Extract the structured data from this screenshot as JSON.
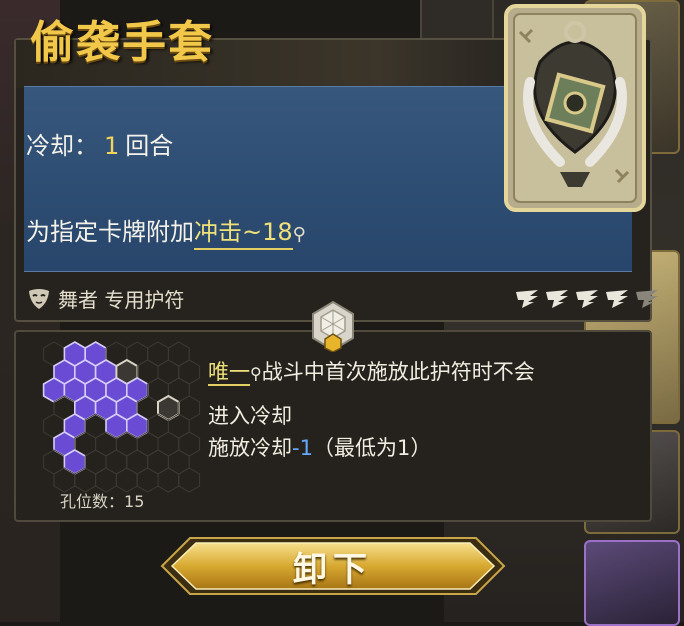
{
  "amulet": {
    "name": "偷袭手套",
    "cooldown_label": "冷却：",
    "cooldown_value": "1",
    "cooldown_unit": "回合",
    "effect_prefix": "为指定卡牌附加",
    "effect_keyword": "冲击~18",
    "owner_text": "舞者 专用护符",
    "icon": "gauntlet-relic-icon"
  },
  "sockets": {
    "holes_label": "孔位数：",
    "holes_value": "15"
  },
  "unique": {
    "keyword": "唯一",
    "line1_rest": "战斗中首次施放此护符时不会",
    "line2": "进入冷却",
    "line3_prefix": "施放冷却",
    "line3_value": "-1",
    "line3_suffix": "（最低为1）"
  },
  "button": {
    "unequip_label": "卸下"
  },
  "colors": {
    "title_gold": "#f1c84a",
    "effect_blue": "#2e4d72",
    "keyword_yellow": "#f0e07a",
    "value_blue": "#66a8ff",
    "hex_purple": "#6a4bd4"
  }
}
